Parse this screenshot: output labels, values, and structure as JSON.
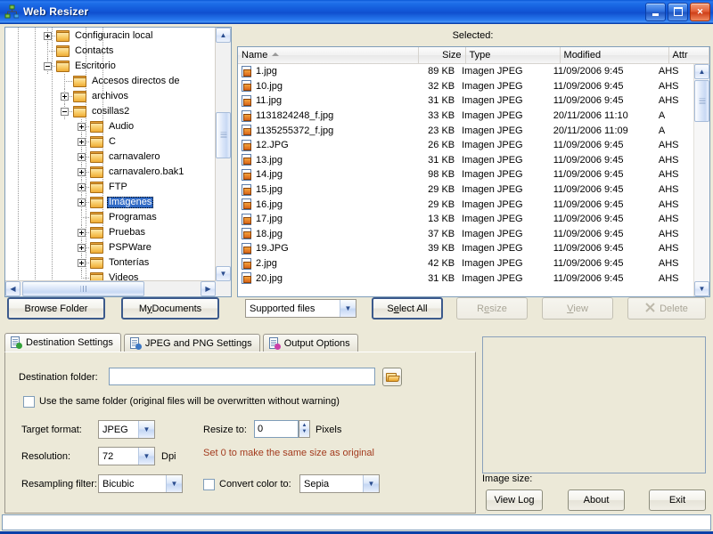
{
  "window": {
    "title": "Web Resizer",
    "app_icon": "app-network-icon",
    "controls": {
      "minimize": "minimize-icon",
      "maximize": "maximize-icon",
      "close": "✕"
    },
    "titlebar_color": "#1257d8",
    "face_color": "#ece9d8"
  },
  "tree": {
    "items": [
      {
        "label": "Configuracin local",
        "depth": 3,
        "toggle": "plus",
        "selected": false
      },
      {
        "label": "Contacts",
        "depth": 3,
        "toggle": "none",
        "selected": false
      },
      {
        "label": "Escritorio",
        "depth": 3,
        "toggle": "minus",
        "selected": false
      },
      {
        "label": "Accesos directos de",
        "depth": 4,
        "toggle": "none",
        "selected": false
      },
      {
        "label": "archivos",
        "depth": 4,
        "toggle": "plus",
        "selected": false
      },
      {
        "label": "cosillas2",
        "depth": 4,
        "toggle": "minus",
        "selected": false
      },
      {
        "label": "Audio",
        "depth": 5,
        "toggle": "plus",
        "selected": false
      },
      {
        "label": "C",
        "depth": 5,
        "toggle": "plus",
        "selected": false
      },
      {
        "label": "carnavalero",
        "depth": 5,
        "toggle": "plus",
        "selected": false
      },
      {
        "label": "carnavalero.bak1",
        "depth": 5,
        "toggle": "plus",
        "selected": false
      },
      {
        "label": "FTP",
        "depth": 5,
        "toggle": "plus",
        "selected": false
      },
      {
        "label": "Imágenes",
        "depth": 5,
        "toggle": "plus",
        "selected": true
      },
      {
        "label": "Programas",
        "depth": 5,
        "toggle": "none",
        "selected": false
      },
      {
        "label": "Pruebas",
        "depth": 5,
        "toggle": "plus",
        "selected": false
      },
      {
        "label": "PSPWare",
        "depth": 5,
        "toggle": "plus",
        "selected": false
      },
      {
        "label": "Tonterías",
        "depth": 5,
        "toggle": "plus",
        "selected": false
      },
      {
        "label": "Videos",
        "depth": 5,
        "toggle": "none",
        "selected": false
      }
    ],
    "selection_color": "#316ac5"
  },
  "filelist": {
    "selected_label": "Selected:",
    "columns": [
      "Name",
      "Size",
      "Type",
      "Modified",
      "Attr"
    ],
    "sort_column": "Name",
    "sort_direction": "ascending",
    "rows": [
      {
        "name": "1.jpg",
        "size": "89 KB",
        "type": "Imagen JPEG",
        "modified": "11/09/2006 9:45",
        "attr": "AHS"
      },
      {
        "name": "10.jpg",
        "size": "32 KB",
        "type": "Imagen JPEG",
        "modified": "11/09/2006 9:45",
        "attr": "AHS"
      },
      {
        "name": "11.jpg",
        "size": "31 KB",
        "type": "Imagen JPEG",
        "modified": "11/09/2006 9:45",
        "attr": "AHS"
      },
      {
        "name": "1131824248_f.jpg",
        "size": "33 KB",
        "type": "Imagen JPEG",
        "modified": "20/11/2006 11:10",
        "attr": "A"
      },
      {
        "name": "1135255372_f.jpg",
        "size": "23 KB",
        "type": "Imagen JPEG",
        "modified": "20/11/2006 11:09",
        "attr": "A"
      },
      {
        "name": "12.JPG",
        "size": "26 KB",
        "type": "Imagen JPEG",
        "modified": "11/09/2006 9:45",
        "attr": "AHS"
      },
      {
        "name": "13.jpg",
        "size": "31 KB",
        "type": "Imagen JPEG",
        "modified": "11/09/2006 9:45",
        "attr": "AHS"
      },
      {
        "name": "14.jpg",
        "size": "98 KB",
        "type": "Imagen JPEG",
        "modified": "11/09/2006 9:45",
        "attr": "AHS"
      },
      {
        "name": "15.jpg",
        "size": "29 KB",
        "type": "Imagen JPEG",
        "modified": "11/09/2006 9:45",
        "attr": "AHS"
      },
      {
        "name": "16.jpg",
        "size": "29 KB",
        "type": "Imagen JPEG",
        "modified": "11/09/2006 9:45",
        "attr": "AHS"
      },
      {
        "name": "17.jpg",
        "size": "13 KB",
        "type": "Imagen JPEG",
        "modified": "11/09/2006 9:45",
        "attr": "AHS"
      },
      {
        "name": "18.jpg",
        "size": "37 KB",
        "type": "Imagen JPEG",
        "modified": "11/09/2006 9:45",
        "attr": "AHS"
      },
      {
        "name": "19.JPG",
        "size": "39 KB",
        "type": "Imagen JPEG",
        "modified": "11/09/2006 9:45",
        "attr": "AHS"
      },
      {
        "name": "2.jpg",
        "size": "42 KB",
        "type": "Imagen JPEG",
        "modified": "11/09/2006 9:45",
        "attr": "AHS"
      },
      {
        "name": "20.jpg",
        "size": "31 KB",
        "type": "Imagen JPEG",
        "modified": "11/09/2006 9:45",
        "attr": "AHS"
      }
    ]
  },
  "toolbar": {
    "browse_folder": "Browse Folder",
    "my_documents_pre": "M",
    "my_documents_accel": "y",
    "my_documents_post": " Documents",
    "filter_value": "Supported files",
    "select_all_pre": "S",
    "select_all_accel": "e",
    "select_all_post": "lect All",
    "resize_pre": "R",
    "resize_accel": "e",
    "resize_post": "size",
    "view_pre": "",
    "view_accel": "V",
    "view_post": "iew",
    "delete": "Delete",
    "delete_icon": "delete-x-icon"
  },
  "tabs": [
    {
      "label": "Destination Settings",
      "icon": "document-check-icon",
      "active": true
    },
    {
      "label": "JPEG and PNG Settings",
      "icon": "image-picture-icon",
      "active": false
    },
    {
      "label": "Output Options",
      "icon": "document-plus-icon",
      "active": false
    }
  ],
  "destination": {
    "folder_label": "Destination folder:",
    "folder_value": "",
    "folder_placeholder": "",
    "browse_icon": "open-folder-icon",
    "same_folder_label": "Use the same folder (original files will be overwritten without warning)",
    "same_folder_checked": false,
    "target_format_label": "Target format:",
    "target_format_value": "JPEG",
    "resolution_label": "Resolution:",
    "resolution_value": "72",
    "dpi_label": "Dpi",
    "resize_to_label": "Resize to:",
    "resize_to_value": "0",
    "pixels_label": "Pixels",
    "hint": "Set 0 to make the same size as original",
    "hint_color": "#a33b1e",
    "resampling_label": "Resampling filter:",
    "resampling_value": "Bicubic",
    "convert_color_label": "Convert color to:",
    "convert_color_checked": false,
    "convert_color_value": "Sepia"
  },
  "right_panel": {
    "image_size_label": "Image size:",
    "view_log": "View Log",
    "about": "About",
    "exit": "Exit"
  },
  "statusbar": {
    "text": ""
  }
}
